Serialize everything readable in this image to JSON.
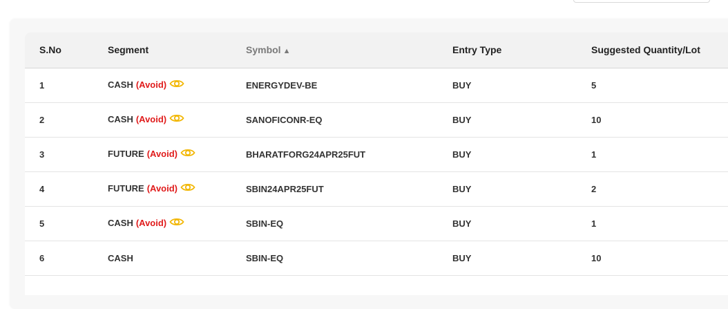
{
  "table": {
    "columns": [
      "S.No",
      "Segment",
      "Symbol",
      "Entry Type",
      "Suggested Quantity/Lot"
    ],
    "sort_indicator": "▲",
    "rows": [
      {
        "sno": "1",
        "segment": "CASH",
        "flag": "(Avoid)",
        "symbol": "ENERGYDEV-BE",
        "entry": "BUY",
        "qty": "5"
      },
      {
        "sno": "2",
        "segment": "CASH",
        "flag": "(Avoid)",
        "symbol": "SANOFICONR-EQ",
        "entry": "BUY",
        "qty": "10"
      },
      {
        "sno": "3",
        "segment": "FUTURE",
        "flag": "(Avoid)",
        "symbol": "BHARATFORG24APR25FUT",
        "entry": "BUY",
        "qty": "1"
      },
      {
        "sno": "4",
        "segment": "FUTURE",
        "flag": "(Avoid)",
        "symbol": "SBIN24APR25FUT",
        "entry": "BUY",
        "qty": "2"
      },
      {
        "sno": "5",
        "segment": "CASH",
        "flag": "(Avoid)",
        "symbol": "SBIN-EQ",
        "entry": "BUY",
        "qty": "1"
      },
      {
        "sno": "6",
        "segment": "CASH",
        "flag": "",
        "symbol": "SBIN-EQ",
        "entry": "BUY",
        "qty": "10"
      }
    ]
  },
  "colors": {
    "avoid": "#e01b1b",
    "eye_icon": "#f2b705",
    "header_bg": "#f2f2f2"
  },
  "icons": {
    "view": "eye-icon"
  }
}
